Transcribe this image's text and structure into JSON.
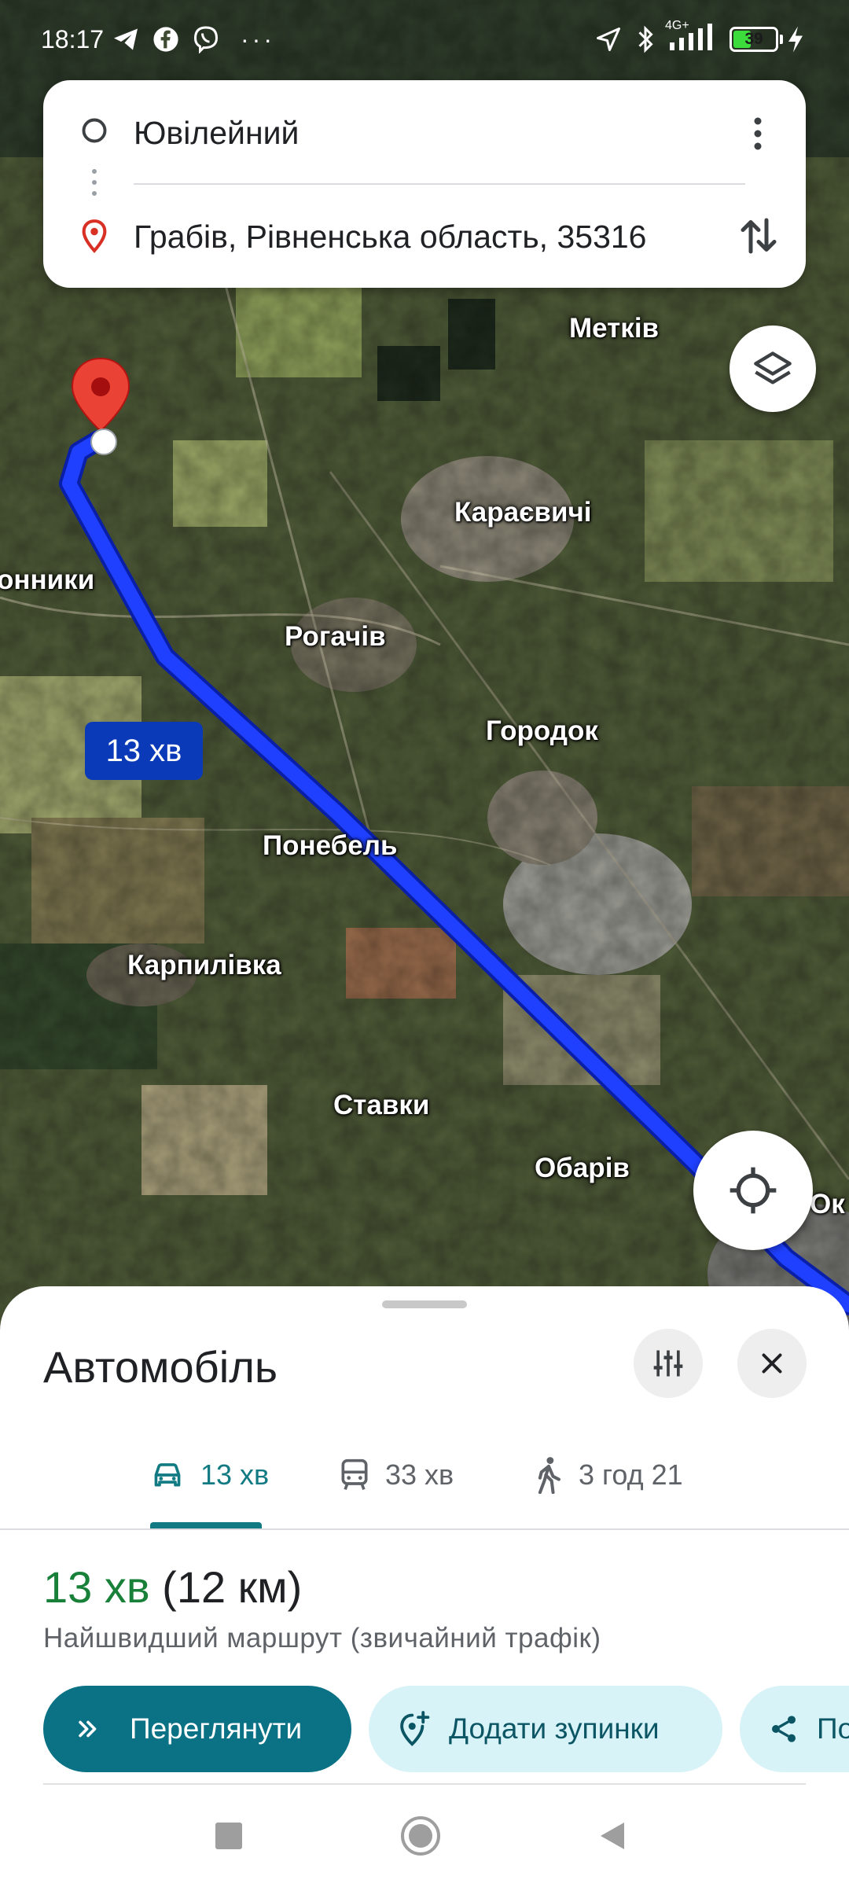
{
  "status_bar": {
    "time": "18:17",
    "left_icons": [
      "telegram-icon",
      "facebook-icon",
      "viber-icon",
      "more-dots-icon"
    ],
    "right_icons": [
      "location-arrow-icon",
      "bluetooth-icon",
      "signal-icon",
      "battery-icon",
      "charging-icon"
    ],
    "network": "4G+",
    "battery": "39"
  },
  "search": {
    "origin": "Ювілейний",
    "destination": "Грабів, Рівненська область, 35316"
  },
  "map": {
    "labels": [
      "Метків",
      "Караєвичі",
      "онники",
      "Рогачів",
      "Городок",
      "Понебель",
      "Карпилівка",
      "Ставки",
      "Обарів",
      "Ок"
    ],
    "route_time_badge": "13 хв",
    "route_color": "#1a3cff"
  },
  "sheet": {
    "title": "Автомобіль",
    "modes": [
      {
        "icon": "car-icon",
        "label": "13 хв",
        "active": true
      },
      {
        "icon": "transit-icon",
        "label": "33 хв",
        "active": false
      },
      {
        "icon": "walk-icon",
        "label": "3 год 21",
        "active": false
      }
    ],
    "route_time": "13 хв",
    "route_distance": "(12 км)",
    "route_description": "Найшвидший маршрут (звичайний трафік)",
    "buttons": {
      "preview": "Переглянути",
      "add_stops": "Додати зупинки",
      "share": "По"
    }
  },
  "colors": {
    "accent": "#0b7285",
    "time_green": "#188038",
    "pill_light": "#d7f3f7"
  }
}
